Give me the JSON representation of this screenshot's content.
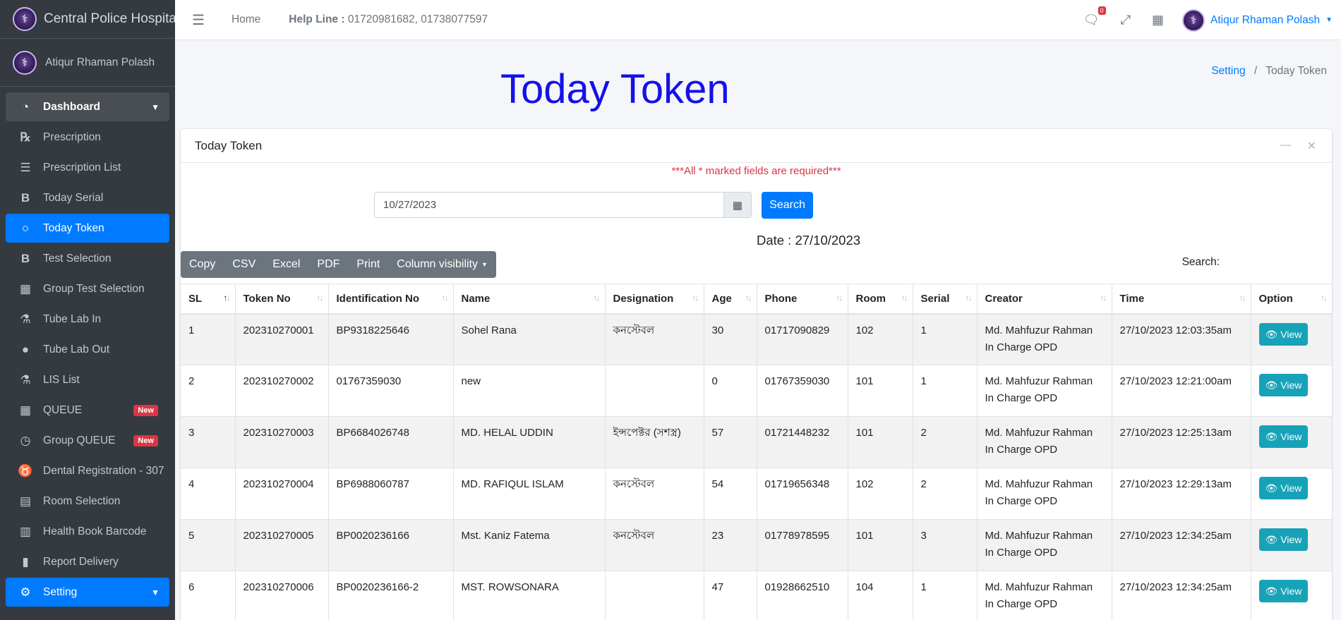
{
  "brand": {
    "name": "Central Police Hospital"
  },
  "user": {
    "name": "Atiqur Rhaman Polash"
  },
  "sidebar": {
    "items": [
      {
        "label": "Dashboard",
        "icon": "tachometer-icon"
      },
      {
        "label": "Prescription",
        "icon": "prescription-icon"
      },
      {
        "label": "Prescription List",
        "icon": "list-icon"
      },
      {
        "label": "Today Serial",
        "icon": "bold-b-icon"
      },
      {
        "label": "Today Token",
        "icon": "circle-icon"
      },
      {
        "label": "Test Selection",
        "icon": "bold-b-icon"
      },
      {
        "label": "Group Test Selection",
        "icon": "hospital-icon"
      },
      {
        "label": "Tube Lab In",
        "icon": "flask-icon"
      },
      {
        "label": "Tube Lab Out",
        "icon": "drop-icon"
      },
      {
        "label": "LIS List",
        "icon": "flask-icon"
      },
      {
        "label": "QUEUE",
        "icon": "grid-icon",
        "badge": "New"
      },
      {
        "label": "Group QUEUE",
        "icon": "clock-icon",
        "badge": "New"
      },
      {
        "label": "Dental Registration - 307",
        "icon": "tooth-icon"
      },
      {
        "label": "Room Selection",
        "icon": "box-icon"
      },
      {
        "label": "Health Book Barcode",
        "icon": "barcode-icon"
      },
      {
        "label": "Report Delivery",
        "icon": "file-icon"
      },
      {
        "label": "Setting",
        "icon": "gear-icon"
      }
    ]
  },
  "topnav": {
    "home": "Home",
    "helpline_label": "Help Line :",
    "helpline_numbers": "01720981682, 01738077597",
    "message_count": "0",
    "user_name": "Atiqur Rhaman Polash"
  },
  "header": {
    "title": "Today Token",
    "breadcrumb": [
      "Setting",
      "Today Token"
    ]
  },
  "card": {
    "title": "Today Token",
    "required_note": "***All * marked fields are required***",
    "date_value": "10/27/2023",
    "search_label": "Search",
    "date_text": "Date : 27/10/2023",
    "table_search_label": "Search:"
  },
  "dt_buttons": [
    "Copy",
    "CSV",
    "Excel",
    "PDF",
    "Print",
    "Column visibility"
  ],
  "table": {
    "headers": [
      "SL",
      "Token No",
      "Identification No",
      "Name",
      "Designation",
      "Age",
      "Phone",
      "Room",
      "Serial",
      "Creator",
      "Time",
      "Option"
    ],
    "view_label": "View",
    "rows": [
      {
        "sl": "1",
        "token": "202310270001",
        "id": "BP9318225646",
        "name": "Sohel Rana",
        "designation": "কনস্টেবল",
        "age": "30",
        "phone": "01717090829",
        "room": "102",
        "serial": "1",
        "creator": "Md. Mahfuzur Rahman",
        "creator_role": "In Charge OPD",
        "time": "27/10/2023 12:03:35am"
      },
      {
        "sl": "2",
        "token": "202310270002",
        "id": "01767359030",
        "name": "new",
        "designation": "",
        "age": "0",
        "phone": "01767359030",
        "room": "101",
        "serial": "1",
        "creator": "Md. Mahfuzur Rahman",
        "creator_role": "In Charge OPD",
        "time": "27/10/2023 12:21:00am"
      },
      {
        "sl": "3",
        "token": "202310270003",
        "id": "BP6684026748",
        "name": "MD. HELAL UDDIN",
        "designation": "ইন্সপেক্টর (সশস্ত্র)",
        "age": "57",
        "phone": "01721448232",
        "room": "101",
        "serial": "2",
        "creator": "Md. Mahfuzur Rahman",
        "creator_role": "In Charge OPD",
        "time": "27/10/2023 12:25:13am"
      },
      {
        "sl": "4",
        "token": "202310270004",
        "id": "BP6988060787",
        "name": "MD. RAFIQUL ISLAM",
        "designation": "কনস্টেবল",
        "age": "54",
        "phone": "01719656348",
        "room": "102",
        "serial": "2",
        "creator": "Md. Mahfuzur Rahman",
        "creator_role": "In Charge OPD",
        "time": "27/10/2023 12:29:13am"
      },
      {
        "sl": "5",
        "token": "202310270005",
        "id": "BP0020236166",
        "name": "Mst. Kaniz Fatema",
        "designation": "কনস্টেবল",
        "age": "23",
        "phone": "01778978595",
        "room": "101",
        "serial": "3",
        "creator": "Md. Mahfuzur Rahman",
        "creator_role": "In Charge OPD",
        "time": "27/10/2023 12:34:25am"
      },
      {
        "sl": "6",
        "token": "202310270006",
        "id": "BP0020236166-2",
        "name": "MST. ROWSONARA",
        "designation": "",
        "age": "47",
        "phone": "01928662510",
        "room": "104",
        "serial": "1",
        "creator": "Md. Mahfuzur Rahman",
        "creator_role": "In Charge OPD",
        "time": "27/10/2023 12:34:25am"
      }
    ]
  }
}
